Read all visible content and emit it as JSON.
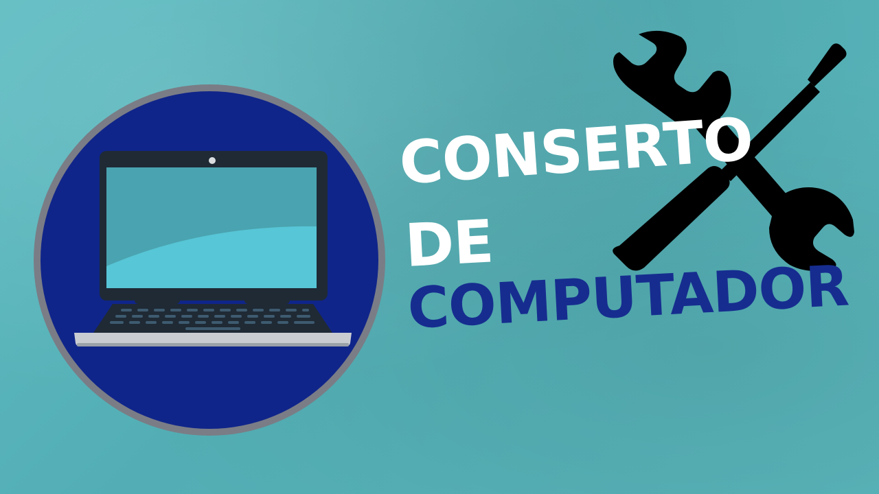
{
  "title": {
    "line1": "CONSERTO",
    "line2": "DE",
    "line3": "COMPUTADOR"
  },
  "icons": {
    "laptop": "laptop-icon",
    "tools": "wrench-screwdriver-icon"
  },
  "colors": {
    "background": "#57b3b9",
    "circle_fill": "#10258a",
    "circle_ring": "#7a7d86",
    "title_white": "#ffffff",
    "title_blue": "#162d8f",
    "tools": "#000000"
  }
}
